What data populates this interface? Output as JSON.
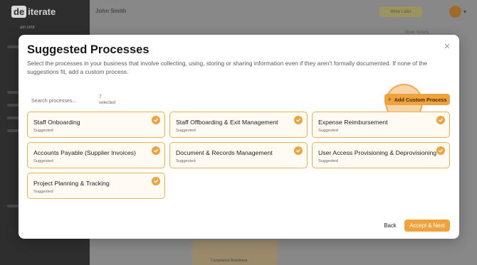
{
  "background": {
    "logo_mark": "de",
    "logo_word": "iterate",
    "sidebar_sub": "ain smit",
    "user_name": "John Smith",
    "header_pill": "Write Later",
    "right_link": "Show history",
    "bottom_label": "Compliance Readiness"
  },
  "modal": {
    "title": "Suggested Processes",
    "description": "Select the processes in your business that involve collecting, using, storing or sharing information even if they aren't formally documented. If none of the suggestions fit, add a custom process.",
    "close_icon": "close-icon",
    "search": {
      "placeholder": "Search processes...",
      "value": ""
    },
    "selected_count": "7",
    "selected_label": "selected",
    "add_button_label": "Add Custom Process",
    "processes": [
      {
        "name": "Staff Onboarding",
        "status": "Suggested",
        "selected": true
      },
      {
        "name": "Staff Offboarding & Exit Management",
        "status": "Suggested",
        "selected": true
      },
      {
        "name": "Expense Reimbursement",
        "status": "Suggested",
        "selected": true
      },
      {
        "name": "Accounts Payable (Supplier Invoices)",
        "status": "Suggested",
        "selected": true
      },
      {
        "name": "Document & Records Management",
        "status": "Suggested",
        "selected": true
      },
      {
        "name": "User Access Provisioning & Deprovisioning",
        "status": "Suggested",
        "selected": true
      },
      {
        "name": "Project Planning & Tracking",
        "status": "Suggested",
        "selected": true
      }
    ],
    "back_label": "Back",
    "next_label": "Accept & Next"
  },
  "colors": {
    "accent": "#f0a33d",
    "card_border": "#f0b04a",
    "card_bg": "#fffaf2"
  }
}
